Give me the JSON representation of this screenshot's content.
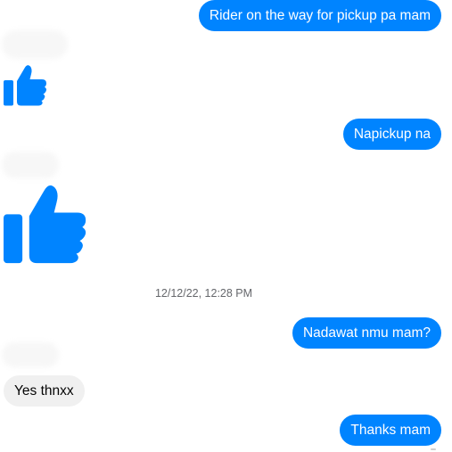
{
  "colors": {
    "outgoing_bubble": "#0084ff",
    "incoming_bubble": "#f0f0f0",
    "like_icon": "#0084ff",
    "timestamp_text": "#65676b"
  },
  "messages": {
    "m1": "Rider on the way for pickup pa mam",
    "m2": "Napickup na",
    "m3": "Nadawat nmu mam?",
    "m4": "Yes thnxx",
    "m5": "Thanks mam"
  },
  "timestamp": "12/12/22, 12:28 PM",
  "icons": {
    "like_small": "thumbs-up-icon",
    "like_large": "thumbs-up-icon"
  }
}
